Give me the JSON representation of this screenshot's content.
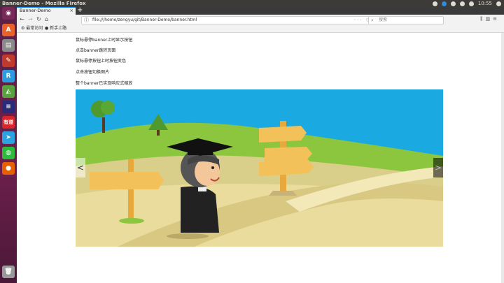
{
  "top_panel": {
    "title": "Banner-Demo - Mozilla Firefox",
    "time": "10:55"
  },
  "browser": {
    "tab_title": "Banner-Demo",
    "url": "file:///home/zengyu/git/Banner-Demo/banner.html",
    "url_actions": "··· ♡ ☆",
    "search_placeholder": "搜索",
    "bookmarks": [
      "最常访问",
      "新手上路"
    ]
  },
  "page": {
    "lines": [
      "鼠标悬停banner上时显示按钮",
      "点击banner跳转页面",
      "鼠标悬停按钮上时按钮变色",
      "点击按钮切换图片",
      "整个banner已实现响应式缩放"
    ],
    "banner": {
      "prev_label": "<",
      "next_label": ">"
    }
  },
  "launcher": {
    "icons": [
      "ubuntu-dash-icon",
      "software-center-icon",
      "files-icon",
      "text-editor-icon",
      "rubymine-icon",
      "android-studio-icon",
      "bar-icon",
      "youdao-icon",
      "telegram-icon",
      "wechat-icon",
      "firefox-icon",
      "trash-icon"
    ],
    "colors": {
      "launcher_bg": "#6b1f4a",
      "sky": "#1aa9e0",
      "grass": "#8cc63e",
      "path": "#e9dc9c"
    }
  }
}
